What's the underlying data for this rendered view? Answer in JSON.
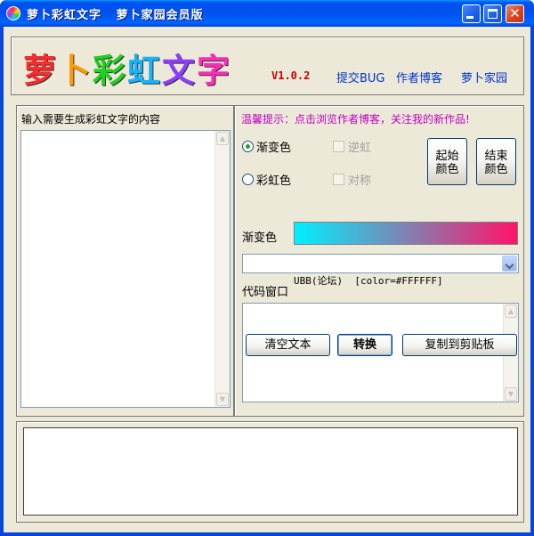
{
  "window": {
    "title": "萝卜彩虹文字   萝卜家园会员版",
    "controls": {
      "minimize": "minimize",
      "maximize": "maximize",
      "close": "✕"
    }
  },
  "banner": {
    "logo_chars": [
      {
        "ch": "萝",
        "color": "#ff2a2a"
      },
      {
        "ch": "卜",
        "color": "#ff9a00"
      },
      {
        "ch": "彩",
        "color": "#1fd21f"
      },
      {
        "ch": "虹",
        "color": "#16b4ff"
      },
      {
        "ch": "文",
        "color": "#8f3cff"
      },
      {
        "ch": "字",
        "color": "#ff2ab8"
      }
    ],
    "version": "V1.0.2",
    "links": {
      "bug": "提交BUG",
      "blog": "作者博客",
      "home": "萝卜家园"
    }
  },
  "input_panel": {
    "label": "输入需要生成彩虹文字的内容",
    "text": ""
  },
  "options": {
    "tip": "温馨提示：点击浏览作者博客，关注我的新作品!",
    "radio_gradient": {
      "label": "渐变色",
      "checked": true
    },
    "radio_rainbow": {
      "label": "彩虹色",
      "checked": false
    },
    "check_reverse": {
      "label": "逆虹",
      "checked": false,
      "enabled": false
    },
    "check_symmetric": {
      "label": "对称",
      "checked": false,
      "enabled": false
    },
    "start_color_label_1": "起始",
    "start_color_label_2": "颜色",
    "end_color_label_1": "结束",
    "end_color_label_2": "颜色",
    "gradient_label": "渐变色",
    "gradient_colors": [
      "#00f0ff",
      "#ff1468"
    ],
    "format_selected": "UBB(论坛)  [color=#FFFFFF]",
    "code_label": "代码窗口",
    "code_text": ""
  },
  "buttons": {
    "clear": "清空文本",
    "convert": "转换",
    "copy": "复制到剪贴板"
  },
  "output": {
    "text": ""
  },
  "icons": {
    "scroll_up": "▲",
    "scroll_down": "▼"
  }
}
